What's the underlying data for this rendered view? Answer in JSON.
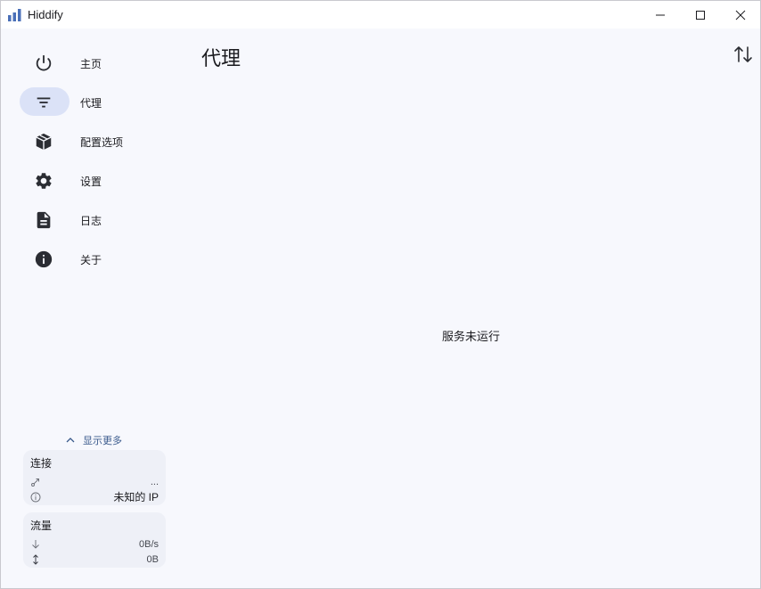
{
  "window": {
    "title": "Hiddify",
    "logo_color": "#4a6fb8"
  },
  "sidebar": {
    "items": [
      {
        "label": "主页",
        "icon": "power-icon",
        "active": false
      },
      {
        "label": "代理",
        "icon": "filter-icon",
        "active": true
      },
      {
        "label": "配置选项",
        "icon": "package-icon",
        "active": false
      },
      {
        "label": "设置",
        "icon": "gear-icon",
        "active": false
      },
      {
        "label": "日志",
        "icon": "document-icon",
        "active": false
      },
      {
        "label": "关于",
        "icon": "info-icon",
        "active": false
      }
    ],
    "show_more": "显示更多",
    "connection_card": {
      "title": "连接",
      "status": "...",
      "ip": "未知的 IP"
    },
    "traffic_card": {
      "title": "流量",
      "speed": "0B/s",
      "total": "0B"
    }
  },
  "main": {
    "title": "代理",
    "empty_message": "服务未运行"
  },
  "colors": {
    "active_pill": "#dbe2f7",
    "background": "#f7f8fd",
    "accent": "#3a5a8c"
  }
}
